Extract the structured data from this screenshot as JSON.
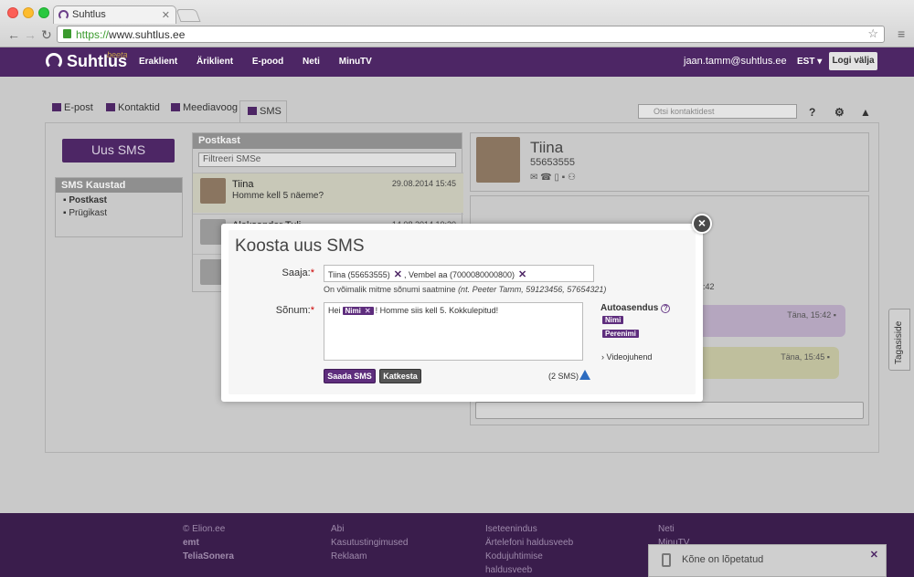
{
  "browser": {
    "tab_title": "Suhtlus",
    "url_scheme": "https://",
    "url_rest": "www.suhtlus.ee"
  },
  "app": {
    "logo": "Suhtlus",
    "beta": "beeta",
    "nav": [
      "Eraklient",
      "Äriklient",
      "E-pood",
      "Neti",
      "MinuTV"
    ],
    "user_email": "jaan.tamm@suhtlus.ee",
    "language": "EST ▾",
    "logout": "Logi välja"
  },
  "page_tabs": {
    "email": "E-post",
    "contacts": "Kontaktid",
    "media": "Meediavoog",
    "sms": "SMS",
    "search_placeholder": "Otsi kontaktidest"
  },
  "left": {
    "new_sms": "Uus SMS",
    "folders_title": "SMS Kaustad",
    "inbox": "Postkast",
    "trash": "Prügikast"
  },
  "inbox": {
    "title": "Postkast",
    "filter_placeholder": "Filtreeri SMSe",
    "messages": [
      {
        "name": "Tiina",
        "snippet": "Homme kell 5 näeme?",
        "date": "29.08.2014 15:45"
      },
      {
        "name": "Aleksander Tuli",
        "snippet": "",
        "date": "14.08.2014 10:30"
      }
    ]
  },
  "contact": {
    "name": "Tiina",
    "number": "55653555",
    "partial_time": ":42",
    "bubbles": [
      {
        "time": "Täna, 15:42"
      },
      {
        "time": "Täna, 15:45"
      }
    ]
  },
  "feedback": "Tagasiside",
  "footer": {
    "col1": [
      "© Elion.ee",
      "emt",
      "TeliaSonera"
    ],
    "col2": [
      "Abi",
      "Kasutustingimused",
      "Reklaam"
    ],
    "col3": [
      "Iseteenindus",
      "Ärtelefoni haldusveeb",
      "Kodujuhtimise haldusveeb"
    ],
    "col4": [
      "Neti",
      "MinuTV"
    ]
  },
  "notification": {
    "text": "Kõne on lõpetatud"
  },
  "modal": {
    "title": "Koosta uus SMS",
    "to_label": "Saaja:",
    "recipient1": "Tiina (55653555)",
    "recipient2": ", Vembel aa (7000080000800)",
    "hint_text": "On võimalik mitme sõnumi saatmine",
    "hint_example": "(nt. Peeter Tamm, 59123456, 57654321)",
    "message_label": "Sõnum:",
    "message_start": "Hei",
    "message_chip": "Nimi",
    "message_end": "! Homme siis kell 5. Kokkulepitud!",
    "autofill_title": "Autoasendus",
    "autofill_chip1": "Nimi",
    "autofill_chip2": "Perenimi",
    "video_link": "› Videojuhend",
    "send": "Saada SMS",
    "cancel": "Katkesta",
    "sms_count": "(2 SMS)"
  }
}
